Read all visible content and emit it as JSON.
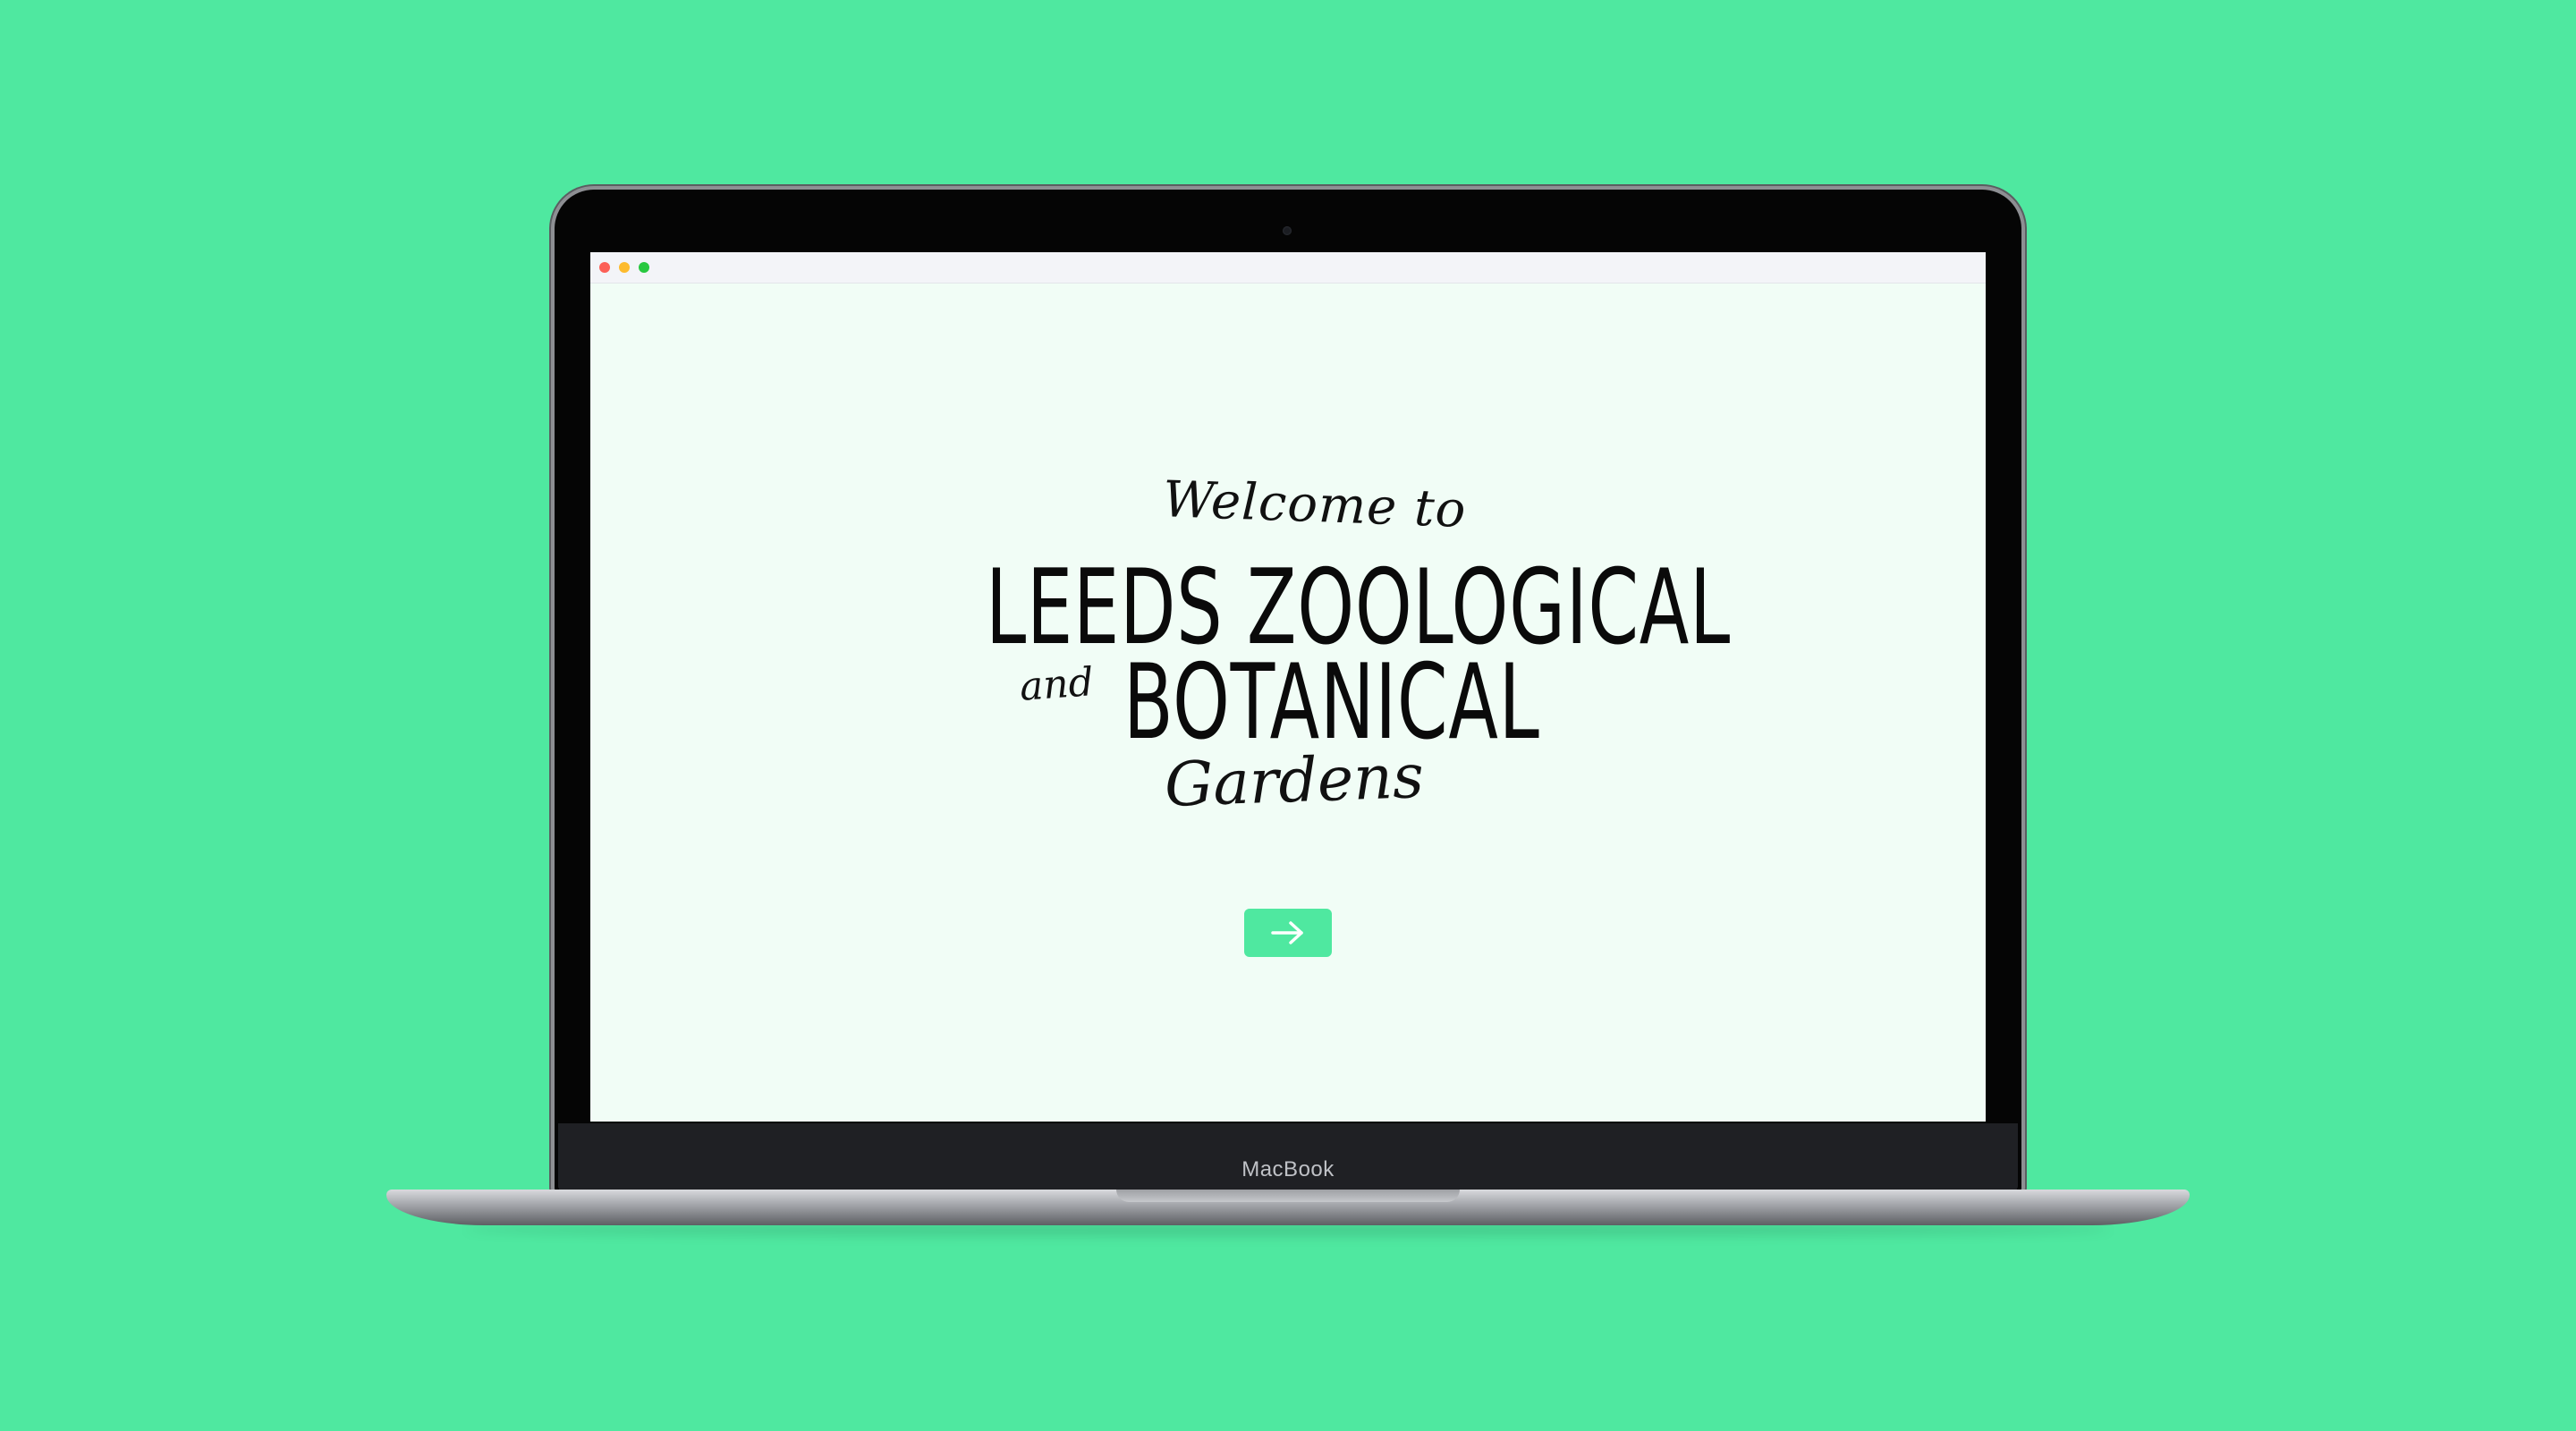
{
  "screen": {
    "welcome_text": "Welcome to",
    "title_line1": "LEEDS ZOOLOGICAL",
    "and_text": "and",
    "title_line2": "BOTANICAL",
    "gardens_text": "Gardens",
    "enter_icon": "arrow-right-icon"
  },
  "device": {
    "label": "MacBook"
  },
  "colors": {
    "background": "#4fe8a0",
    "screen_background": "#f1fdf6",
    "button": "#4fe8a0",
    "traffic_red": "#fc5f57",
    "traffic_yellow": "#fdbb2e",
    "traffic_green": "#28c840"
  }
}
